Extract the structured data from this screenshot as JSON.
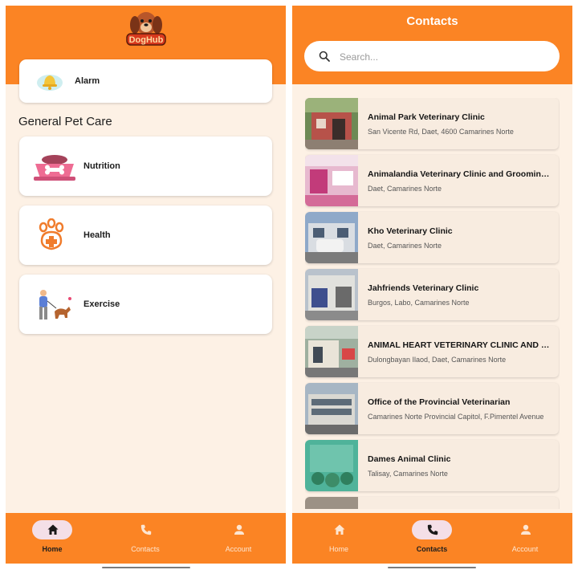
{
  "home": {
    "logo_text": "DogHub",
    "alarm_label": "Alarm",
    "section_title": "General Pet Care",
    "care_items": [
      {
        "label": "Nutrition",
        "icon": "pet-food-bowl-icon"
      },
      {
        "label": "Health",
        "icon": "paw-health-icon"
      },
      {
        "label": "Exercise",
        "icon": "walking-dog-icon"
      }
    ]
  },
  "contacts": {
    "title": "Contacts",
    "search_placeholder": "Search...",
    "clinics": [
      {
        "name": "Animal Park Veterinary Clinic",
        "address": "San Vicente Rd, Daet, 4600 Camarines Norte"
      },
      {
        "name": "Animalandia Veterinary Clinic and Grooming Services",
        "address": "Daet, Camarines Norte"
      },
      {
        "name": "Kho Veterinary Clinic",
        "address": "Daet, Camarines Norte"
      },
      {
        "name": "Jahfriends Veterinary Clinic",
        "address": "Burgos, Labo, Camarines Norte"
      },
      {
        "name": "ANIMAL HEART VETERINARY CLINIC AND GROOMING",
        "address": "Dulongbayan Ilaod, Daet, Camarines Norte"
      },
      {
        "name": "Office of the Provincial Veterinarian",
        "address": "Camarines Norte Provincial Capitol, F.Pimentel Avenue"
      },
      {
        "name": "Dames Animal Clinic",
        "address": "Talisay, Camarines Norte"
      }
    ]
  },
  "nav": {
    "items": [
      {
        "label": "Home",
        "icon": "home-icon"
      },
      {
        "label": "Contacts",
        "icon": "phone-icon"
      },
      {
        "label": "Account",
        "icon": "person-icon"
      }
    ],
    "left_active": "Home",
    "right_active": "Contacts"
  },
  "colors": {
    "primary": "#fb8424",
    "background": "#fdf1e5",
    "card": "#ffffff",
    "active_pill": "#f4dfe7"
  }
}
